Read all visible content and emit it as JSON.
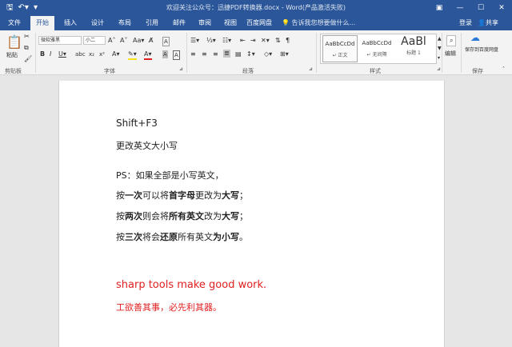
{
  "titlebar": {
    "save_icon": "save-icon",
    "undo_icon": "undo-icon",
    "title": "欢迎关注公众号：迅捷PDF转换器.docx - Word(产品激活失败)",
    "buttons": [
      "ribbon-display-icon",
      "minimize-icon",
      "maximize-icon",
      "close-icon"
    ]
  },
  "tabs": [
    "文件",
    "开始",
    "插入",
    "设计",
    "布局",
    "引用",
    "邮件",
    "审阅",
    "视图",
    "百度网盘"
  ],
  "active_tab": "开始",
  "tell_me": "告诉我您想要做什么...",
  "sign_in": "登录",
  "share": "共享",
  "ribbon": {
    "clipboard": {
      "paste": "粘贴",
      "label": "剪贴板"
    },
    "font": {
      "name": "微软雅黑",
      "size": "小二",
      "label": "字体"
    },
    "paragraph": {
      "label": "段落"
    },
    "styles": {
      "items": [
        {
          "sample": "AaBbCcDd",
          "name": "↵ 正文"
        },
        {
          "sample": "AaBbCcDd",
          "name": "↵ 无间隔"
        },
        {
          "sample": "AaBl",
          "name": "标题 1"
        }
      ],
      "label": "样式"
    },
    "editing": {
      "label": "编辑"
    },
    "save": {
      "button": "保存到百度网盘",
      "label": "保存"
    }
  },
  "document": {
    "lines": [
      "Shift+F3",
      "更改英文大小写",
      "PS：如果全部是小写英文，",
      "按一次可以将首字母更改为大写；",
      "按两次则会将所有英文改为大写；",
      "按三次将会还原所有英文为小写。",
      "sharp tools make good work.",
      "工欲善其事，必先利其器。"
    ],
    "accent_color": "#e02020"
  },
  "colors": {
    "title_bar": "#2b579a",
    "ribbon": "#f3f3f3",
    "background": "#e6e6e6"
  }
}
